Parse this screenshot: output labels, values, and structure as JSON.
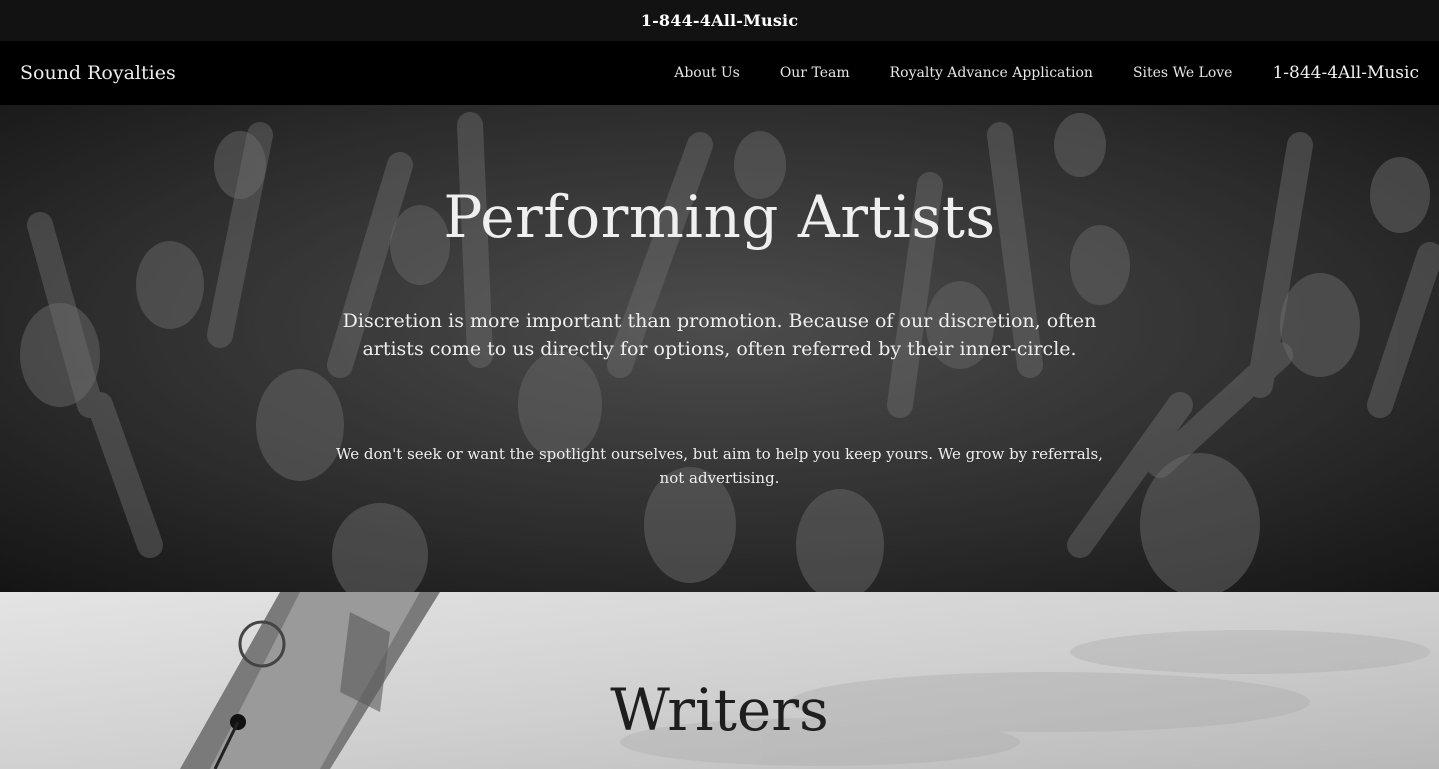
{
  "topbar": {
    "phone": "1-844-4All-Music"
  },
  "nav": {
    "brand": "Sound Royalties",
    "links": [
      "About Us",
      "Our Team",
      "Royalty Advance Application",
      "Sites We Love"
    ],
    "phone": "1-844-4All-Music"
  },
  "hero": {
    "title": "Performing Artists",
    "lead": "Discretion is more important than promotion. Because of our discretion, often artists come to us directly for options, often referred by their inner-circle.",
    "sub": "We don't seek or want the spotlight ourselves, but aim to help you keep yours. We grow by referrals, not advertising."
  },
  "writers": {
    "title": "Writers"
  },
  "colors": {
    "topbar_bg": "#121212",
    "nav_bg": "#000000",
    "hero_text": "#efefef",
    "writers_text": "#1e1e1e"
  }
}
